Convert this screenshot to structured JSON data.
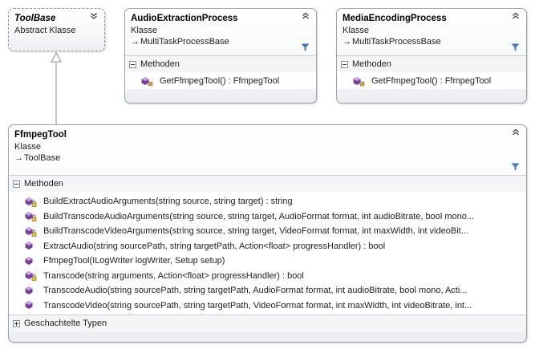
{
  "colors": {
    "method_icon": "#7a3e9d",
    "border": "#9aa2ad",
    "filter": "#3b79c6",
    "connector": "#8c8c8c"
  },
  "tool_base": {
    "name": "ToolBase",
    "kind": "Abstract Klasse"
  },
  "audio_extraction": {
    "name": "AudioExtractionProcess",
    "kind": "Klasse",
    "base": "MultiTaskProcessBase",
    "section": "Methoden",
    "methods": [
      {
        "label": "GetFfmpegTool() : FfmpegTool",
        "icon": "method-protected-icon"
      }
    ]
  },
  "media_encoding": {
    "name": "MediaEncodingProcess",
    "kind": "Klasse",
    "base": "MultiTaskProcessBase",
    "section": "Methoden",
    "methods": [
      {
        "label": "GetFfmpegTool() : FfmpegTool",
        "icon": "method-protected-icon"
      }
    ]
  },
  "ffmpeg_tool": {
    "name": "FfmpegTool",
    "kind": "Klasse",
    "base": "ToolBase",
    "section": "Methoden",
    "methods": [
      {
        "label": "BuildExtractAudioArguments(string source, string target) : string",
        "icon": "method-private-icon"
      },
      {
        "label": "BuildTranscodeAudioArguments(string source, string target, AudioFormat format, int audioBitrate, bool mono...",
        "icon": "method-private-icon"
      },
      {
        "label": "BuildTranscodeVideoArguments(string source, string target, VideoFormat format, int maxWidth, int videoBit...",
        "icon": "method-private-icon"
      },
      {
        "label": "ExtractAudio(string sourcePath, string targetPath, Action<float> progressHandler) : bool",
        "icon": "method-public-icon"
      },
      {
        "label": "FfmpegTool(ILogWriter logWriter, Setup setup)",
        "icon": "method-public-icon"
      },
      {
        "label": "Transcode(string arguments, Action<float> progressHandler) : bool",
        "icon": "method-private-icon"
      },
      {
        "label": "TranscodeAudio(string sourcePath, string targetPath, AudioFormat format, int audioBitrate, bool mono, Acti...",
        "icon": "method-public-icon"
      },
      {
        "label": "TranscodeVideo(string sourcePath, string targetPath, VideoFormat format, int maxWidth, int videoBitrate, int...",
        "icon": "method-public-icon"
      }
    ],
    "nested_section": "Geschachtelte Typen"
  }
}
